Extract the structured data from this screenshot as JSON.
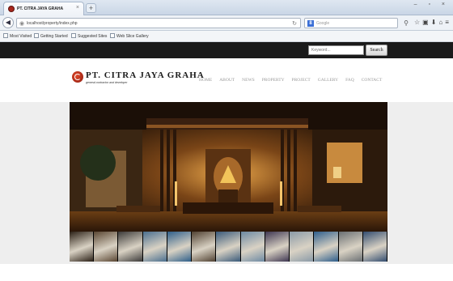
{
  "browser": {
    "tab": {
      "title": "PT. CITRA JAYA GRAHA",
      "close": "×"
    },
    "new_tab": "+",
    "url": "localhost/property/index.php",
    "search_engine_letter": "8",
    "search_placeholder": "Google",
    "bookmarks": [
      "Most Visited",
      "Getting Started",
      "Suggested Sites",
      "Web Slice Gallery"
    ]
  },
  "site": {
    "search": {
      "placeholder": "Keyword...",
      "button": "Search"
    },
    "logo": {
      "name": "PT. CITRA JAYA GRAHA",
      "tagline": "general contractor and developer",
      "color": "#b1281a"
    },
    "menu": [
      "HOME",
      "ABOUT",
      "NEWS",
      "PROPERTY",
      "PROJECT",
      "GALLERY",
      "FAQ",
      "CONTACT"
    ],
    "slider": {
      "thumbnail_count": 13
    }
  }
}
